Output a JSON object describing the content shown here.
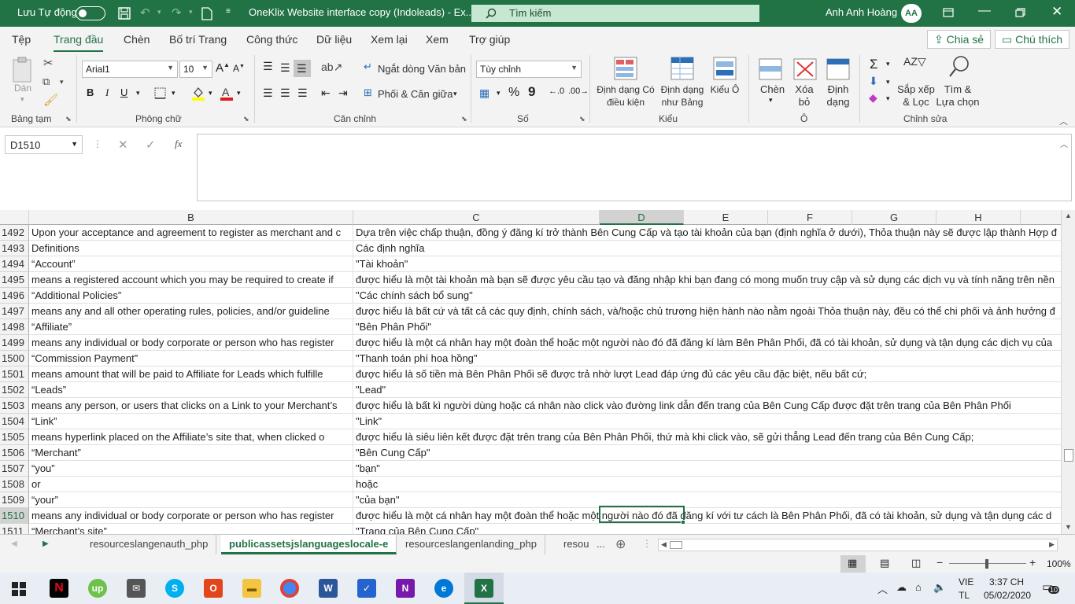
{
  "titlebar": {
    "autosave_label": "Lưu Tự động",
    "doc_title": "OneKlix Website interface copy (Indoleads)  -  Ex...",
    "search_placeholder": "Tìm kiếm",
    "user_name": "Anh Anh Hoàng",
    "user_initials": "AA"
  },
  "menu": {
    "tabs": [
      "Tệp",
      "Trang đầu",
      "Chèn",
      "Bố trí Trang",
      "Công thức",
      "Dữ liệu",
      "Xem lại",
      "Xem",
      "Trợ giúp"
    ],
    "active_tab": "Trang đầu",
    "share_label": "Chia sẻ",
    "comments_label": "Chú thích"
  },
  "ribbon": {
    "clipboard": {
      "paste": "Dán",
      "group": "Bảng tạm"
    },
    "font": {
      "name": "Arial1",
      "size": "10",
      "bold": "B",
      "italic": "I",
      "underline": "U",
      "group": "Phông chữ"
    },
    "alignment": {
      "wrap": "Ngắt dòng Văn bản",
      "merge": "Phối & Căn giữa",
      "group": "Căn chỉnh"
    },
    "number": {
      "format": "Tùy chỉnh",
      "percent": "%",
      "comma": "9",
      "group": "Số"
    },
    "styles": {
      "conditional": "Định dạng Có điều kiện",
      "as_table": "Định dạng như Bảng",
      "cell_styles": "Kiểu Ô",
      "group": "Kiểu"
    },
    "cells": {
      "insert": "Chèn",
      "delete": "Xóa bỏ",
      "format": "Định dạng",
      "group": "Ô"
    },
    "editing": {
      "sort": "Sắp xếp & Lọc",
      "find": "Tìm & Lựa chọn",
      "group": "Chỉnh sửa"
    }
  },
  "formula_bar": {
    "name_box": "D1510",
    "fx": "fx",
    "content": ""
  },
  "grid": {
    "columns": [
      "B",
      "C",
      "D",
      "E",
      "F",
      "G",
      "H"
    ],
    "selected_column": "D",
    "selected_row": "1510",
    "rows": [
      {
        "n": "1492",
        "b": "Upon your acceptance and agreement to register as merchant and c",
        "c": "Dựa trên việc chấp thuận, đồng ý đăng kí trở thành Bên Cung Cấp và tạo tài khoản của bạn (định nghĩa ở dưới), Thỏa thuận này sẽ được lập thành Hợp đ"
      },
      {
        "n": "1493",
        "b": "Definitions",
        "c": "Các định nghĩa"
      },
      {
        "n": "1494",
        "b": "“Account”",
        "c": "\"Tài khoản\""
      },
      {
        "n": "1495",
        "b": "means a registered account which you may be required to create if",
        "c": "được hiểu là một tài khoản mà bạn sẽ được yêu cầu tạo và đăng nhập khi bạn đang có mong muốn truy cập và sử dụng các dịch vụ và tính năng trên nền"
      },
      {
        "n": "1496",
        "b": "“Additional Policies”",
        "c": "\"Các chính sách bổ sung\""
      },
      {
        "n": "1497",
        "b": "means any and all other operating rules, policies, and/or guideline",
        "c": "được hiểu là bất cứ và tất cả các quy định, chính sách, và/hoặc chủ trương hiện hành nào nằm ngoài Thỏa thuận này, đều có thể chi phối và ảnh hưởng đ"
      },
      {
        "n": "1498",
        "b": "“Affiliate”",
        "c": "\"Bên Phân Phối\""
      },
      {
        "n": "1499",
        "b": "means any individual or body corporate or person who has register",
        "c": "được hiểu là một cá nhân hay một đoàn thể hoặc một người nào đó đã đăng kí làm Bên Phân Phối, đã có tài khoản, sử dụng và tận dụng các dịch vụ của"
      },
      {
        "n": "1500",
        "b": "“Commission Payment”",
        "c": "\"Thanh toán phí hoa hồng\""
      },
      {
        "n": "1501",
        "b": "means amount that will be paid to Affiliate for Leads which fulfille",
        "c": "được hiểu là số tiền mà Bên Phân Phối sẽ được trả nhờ lượt Lead đáp ứng đủ các yêu cầu đặc biệt, nếu bất cứ;"
      },
      {
        "n": "1502",
        "b": "“Leads”",
        "c": "\"Lead\""
      },
      {
        "n": "1503",
        "b": "means any person, or users that clicks on a Link to your Merchant’s",
        "c": "được hiểu là bất kì người dùng hoặc cá nhân nào click vào đường link dẫn đến trang của Bên Cung Cấp được đặt trên trang của Bên Phân Phối"
      },
      {
        "n": "1504",
        "b": "“Link”",
        "c": "\"Link\""
      },
      {
        "n": "1505",
        "b": "means hyperlink placed on the Affiliate’s site that, when clicked o",
        "c": "được hiểu là siêu liên kết được đặt trên trang của Bên Phân Phối, thứ mà khi click vào, sẽ gửi thẳng Lead đến trang của Bên Cung Cấp;"
      },
      {
        "n": "1506",
        "b": "“Merchant”",
        "c": "\"Bên Cung Cấp\""
      },
      {
        "n": "1507",
        "b": "“you”",
        "c": "\"bạn\""
      },
      {
        "n": "1508",
        "b": "or",
        "c": "hoặc"
      },
      {
        "n": "1509",
        "b": "“your”",
        "c": "\"của bạn\""
      },
      {
        "n": "1510",
        "b": "means any individual or body corporate or person who has register",
        "c": "được hiểu là một cá nhân hay một đoàn thể hoặc một người nào đó đã đăng kí với tư cách là Bên Phân Phối, đã có tài khoản, sử dụng và tận dụng các d"
      },
      {
        "n": "1511",
        "b": "“Merchant’s site”",
        "c": "\"Trang của Bên Cung Cấp\""
      }
    ]
  },
  "sheets": {
    "tabs": [
      "resourceslangenauth_php",
      "publicassetsjslanguageslocale-e",
      "resourceslangenlanding_php",
      "resou"
    ],
    "active": "publicassetsjslanguageslocale-e",
    "more": "..."
  },
  "status": {
    "zoom": "100%"
  },
  "taskbar": {
    "lang": "VIE",
    "lang2": "TL",
    "time": "3:37 CH",
    "date": "05/02/2020",
    "notifications": "10"
  }
}
